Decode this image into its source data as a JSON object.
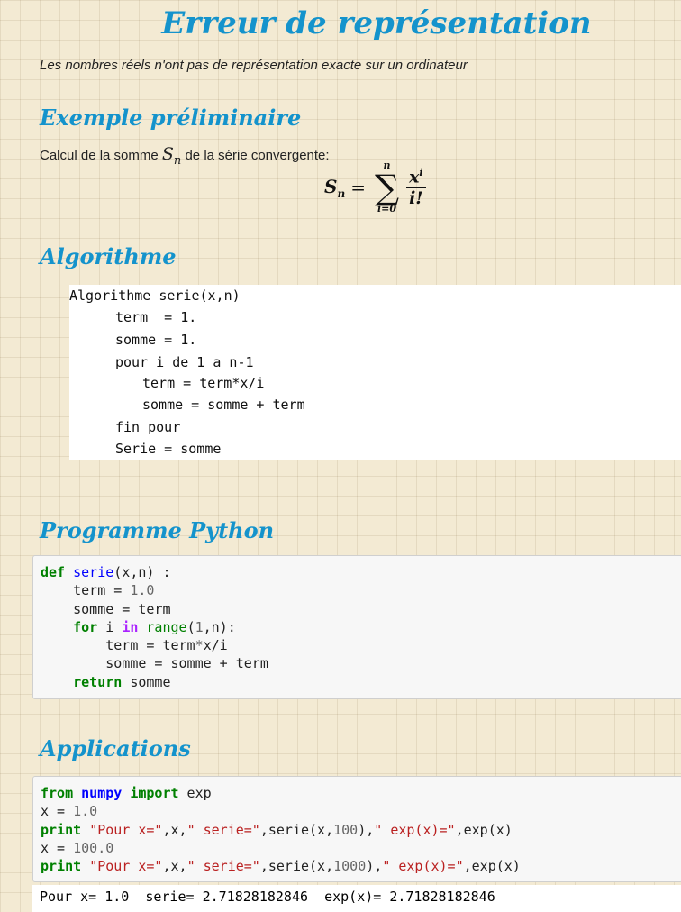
{
  "title": "Erreur de représentation",
  "subtitle": "Les nombres réels n'ont pas de représentation exacte sur un ordinateur",
  "section1": {
    "heading": "Exemple préliminaire",
    "text_before": "Calcul de la somme",
    "math_var": "S",
    "math_sub": "n",
    "text_after": "de la série convergente:",
    "formula": {
      "lhs": "S",
      "lhs_sub": "n",
      "sum_upper": "n",
      "sum_lower": "i=0",
      "numerator": "x",
      "numerator_sup": "i",
      "denominator": "i!"
    }
  },
  "section2": {
    "heading": "Algorithme",
    "lines": [
      "Algorithme serie(x,n)",
      "term  = 1.",
      "somme = 1.",
      "pour i de 1 a n-1",
      "term = term*x/i",
      "somme = somme + term",
      "fin pour",
      "Serie = somme"
    ]
  },
  "section3": {
    "heading": "Programme Python"
  },
  "section4": {
    "heading": "Applications",
    "output_line": "Pour x= 1.0  serie= 2.71828182846  exp(x)= 2.71828182846"
  },
  "colors": {
    "heading": "#1493cc",
    "keyword": "#008000",
    "function": "#0000ff",
    "operator": "#aa22ff",
    "number": "#666666",
    "string": "#ba2121"
  }
}
